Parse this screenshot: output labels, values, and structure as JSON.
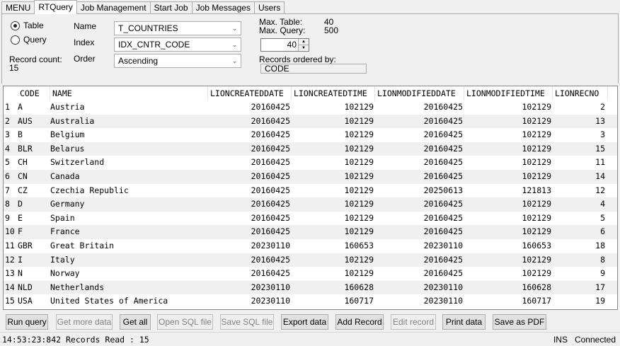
{
  "tabs": [
    "MENU",
    "RTQuery",
    "Job Management",
    "Start Job",
    "Job Messages",
    "Users"
  ],
  "active_tab": "RTQuery",
  "form": {
    "radio_table": "Table",
    "radio_query": "Query",
    "name_label": "Name",
    "name_value": "T_COUNTRIES",
    "index_label": "Index",
    "index_value": "IDX_CNTR_CODE",
    "order_label": "Order",
    "order_value": "Ascending",
    "record_count_label": "Record count:",
    "record_count_value": "15",
    "max_table_label": "Max. Table:",
    "max_table_value": "40",
    "max_query_label": "Max. Query:",
    "max_query_value": "500",
    "limit_value": "40",
    "ordered_by_label": "Records ordered by:",
    "ordered_by_value": "CODE"
  },
  "grid": {
    "columns": [
      "CODE",
      "NAME",
      "LIONCREATEDDATE",
      "LIONCREATEDTIME",
      "LIONMODIFIEDDATE",
      "LIONMODIFIEDTIME",
      "LIONRECNO"
    ],
    "rows": [
      [
        "1",
        "A",
        "Austria",
        "20160425",
        "102129",
        "20160425",
        "102129",
        "2"
      ],
      [
        "2",
        "AUS",
        "Australia",
        "20160425",
        "102129",
        "20160425",
        "102129",
        "13"
      ],
      [
        "3",
        "B",
        "Belgium",
        "20160425",
        "102129",
        "20160425",
        "102129",
        "3"
      ],
      [
        "4",
        "BLR",
        "Belarus",
        "20160425",
        "102129",
        "20160425",
        "102129",
        "15"
      ],
      [
        "5",
        "CH",
        "Switzerland",
        "20160425",
        "102129",
        "20160425",
        "102129",
        "11"
      ],
      [
        "6",
        "CN",
        "Canada",
        "20160425",
        "102129",
        "20160425",
        "102129",
        "14"
      ],
      [
        "7",
        "CZ",
        "Czechia Republic",
        "20160425",
        "102129",
        "20250613",
        "121813",
        "12"
      ],
      [
        "8",
        "D",
        "Germany",
        "20160425",
        "102129",
        "20160425",
        "102129",
        "4"
      ],
      [
        "9",
        "E",
        "Spain",
        "20160425",
        "102129",
        "20160425",
        "102129",
        "5"
      ],
      [
        "10",
        "F",
        "France",
        "20160425",
        "102129",
        "20160425",
        "102129",
        "6"
      ],
      [
        "11",
        "GBR",
        "Great Britain",
        "20230110",
        "160653",
        "20230110",
        "160653",
        "18"
      ],
      [
        "12",
        "I",
        "Italy",
        "20160425",
        "102129",
        "20160425",
        "102129",
        "8"
      ],
      [
        "13",
        "N",
        "Norway",
        "20160425",
        "102129",
        "20160425",
        "102129",
        "9"
      ],
      [
        "14",
        "NLD",
        "Netherlands",
        "20230110",
        "160628",
        "20230110",
        "160628",
        "17"
      ],
      [
        "15",
        "USA",
        "United States of America",
        "20230110",
        "160717",
        "20230110",
        "160717",
        "19"
      ]
    ]
  },
  "buttons": [
    {
      "label": "Run query",
      "enabled": true
    },
    {
      "label": "Get more data",
      "enabled": false
    },
    {
      "label": "Get all",
      "enabled": true
    },
    {
      "label": "Open SQL file",
      "enabled": false
    },
    {
      "label": "Save SQL file",
      "enabled": false
    },
    {
      "label": "Export data",
      "enabled": true
    },
    {
      "label": "Add Record",
      "enabled": true
    },
    {
      "label": "Edit record",
      "enabled": false
    },
    {
      "label": "Print data",
      "enabled": true
    },
    {
      "label": "Save as PDF",
      "enabled": true
    }
  ],
  "status": {
    "message": "14:53:23:842 Records Read : 15",
    "mode": "INS",
    "connection": "Connected"
  }
}
